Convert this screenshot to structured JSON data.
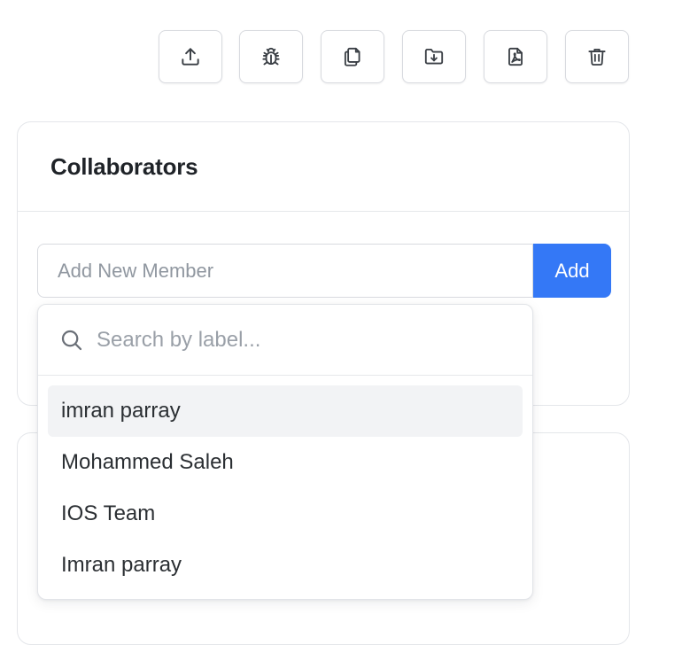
{
  "toolbar": {
    "buttons": [
      {
        "icon": "upload-icon",
        "label": "Upload"
      },
      {
        "icon": "bug-icon",
        "label": "Debug"
      },
      {
        "icon": "copy-icon",
        "label": "Copy"
      },
      {
        "icon": "folder-download-icon",
        "label": "Download"
      },
      {
        "icon": "pdf-file-icon",
        "label": "Export PDF"
      },
      {
        "icon": "trash-icon",
        "label": "Delete"
      }
    ]
  },
  "collaborators": {
    "title": "Collaborators",
    "input_placeholder": "Add New Member",
    "input_value": "",
    "add_label": "Add"
  },
  "dropdown": {
    "search_placeholder": "Search by label...",
    "search_value": "",
    "items": [
      {
        "label": "imran parray",
        "highlighted": true
      },
      {
        "label": "Mohammed Saleh",
        "highlighted": false
      },
      {
        "label": "IOS Team",
        "highlighted": false
      },
      {
        "label": "Imran parray",
        "highlighted": false
      }
    ]
  },
  "colors": {
    "accent": "#3478f6",
    "highlight_row": "#f2f3f5",
    "border": "#d8dadf",
    "text": "#1f2328",
    "placeholder": "#9097a0"
  }
}
